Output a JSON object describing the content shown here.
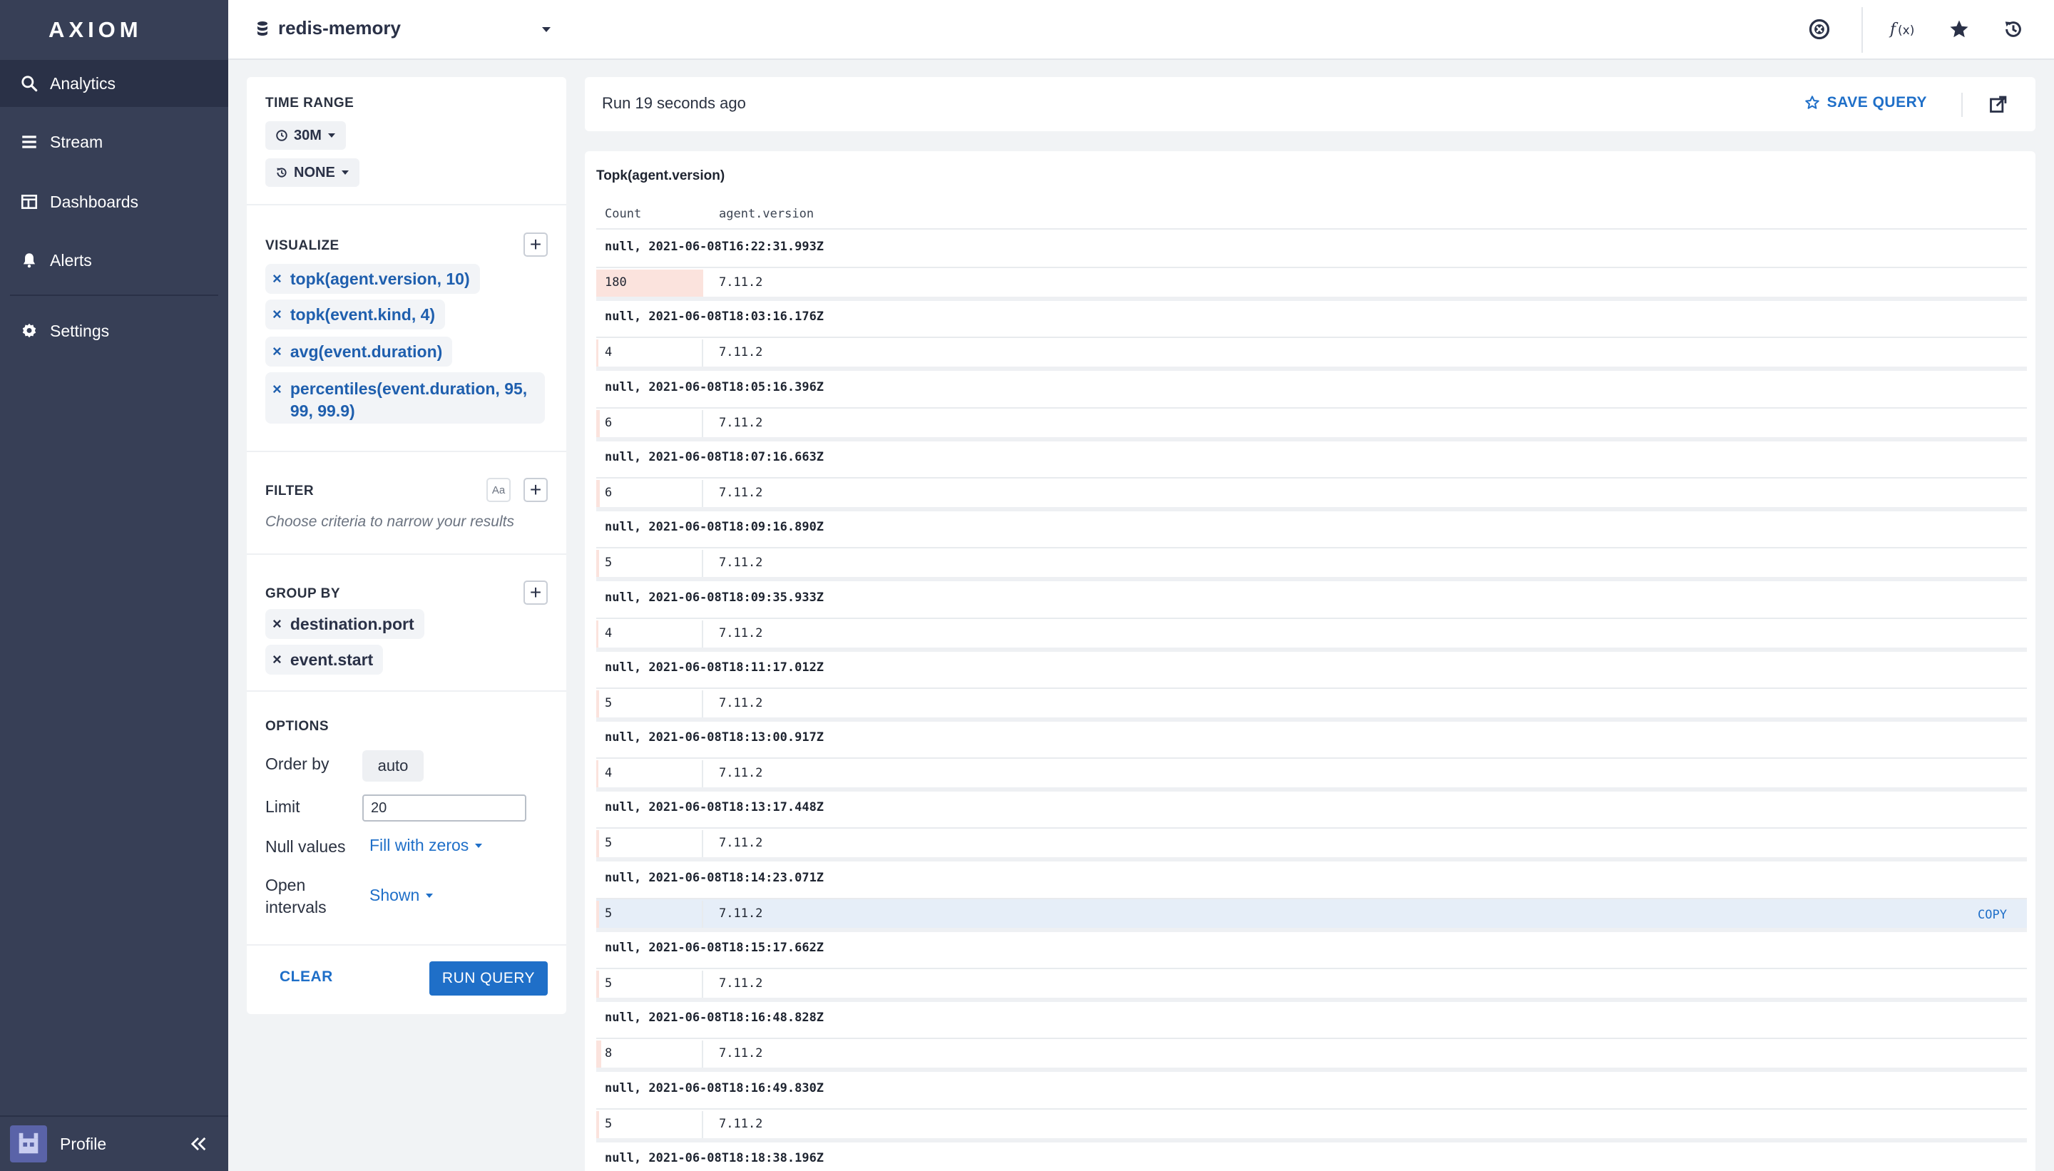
{
  "colors": {
    "sidebar": "#373f56",
    "accent": "#1f6fc8",
    "count_bar": "#fbe3dd"
  },
  "sidebar": {
    "logo": "AXIOM",
    "items": [
      {
        "label": "Analytics",
        "icon": "search-icon",
        "active": true
      },
      {
        "label": "Stream",
        "icon": "stream-icon"
      },
      {
        "label": "Dashboards",
        "icon": "dashboard-icon"
      },
      {
        "label": "Alerts",
        "icon": "bell-icon"
      },
      {
        "label": "Settings",
        "icon": "gear-icon"
      }
    ],
    "profile_label": "Profile"
  },
  "topbar": {
    "dataset": "redis-memory"
  },
  "query": {
    "time_range": {
      "title": "TIME RANGE",
      "range": "30M",
      "compare": "NONE"
    },
    "visualize": {
      "title": "VISUALIZE",
      "items": [
        "topk(agent.version, 10)",
        "topk(event.kind, 4)",
        "avg(event.duration)",
        "percentiles(event.duration, 95, 99, 99.9)"
      ]
    },
    "filter": {
      "title": "FILTER",
      "case_label": "Aa",
      "hint": "Choose criteria to narrow your results"
    },
    "group_by": {
      "title": "GROUP BY",
      "items": [
        "destination.port",
        "event.start"
      ]
    },
    "options": {
      "title": "OPTIONS",
      "order_by_label": "Order by",
      "order_by_value": "auto",
      "limit_label": "Limit",
      "limit_value": "20",
      "null_label": "Null values",
      "null_value": "Fill with zeros",
      "open_label": "Open intervals",
      "open_value": "Shown"
    },
    "clear_label": "CLEAR",
    "run_label": "RUN QUERY"
  },
  "results": {
    "run_status": "Run 19 seconds ago",
    "save_label": "SAVE QUERY",
    "title": "Topk(agent.version)",
    "col_count": "Count",
    "col_version": "agent.version",
    "copy_label": "COPY",
    "max_count": 180,
    "groups": [
      {
        "title": "null, 2021-06-08T16:22:31.993Z",
        "count": 180,
        "version": "7.11.2"
      },
      {
        "title": "null, 2021-06-08T18:03:16.176Z",
        "count": 4,
        "version": "7.11.2"
      },
      {
        "title": "null, 2021-06-08T18:05:16.396Z",
        "count": 6,
        "version": "7.11.2"
      },
      {
        "title": "null, 2021-06-08T18:07:16.663Z",
        "count": 6,
        "version": "7.11.2"
      },
      {
        "title": "null, 2021-06-08T18:09:16.890Z",
        "count": 5,
        "version": "7.11.2"
      },
      {
        "title": "null, 2021-06-08T18:09:35.933Z",
        "count": 4,
        "version": "7.11.2"
      },
      {
        "title": "null, 2021-06-08T18:11:17.012Z",
        "count": 5,
        "version": "7.11.2"
      },
      {
        "title": "null, 2021-06-08T18:13:00.917Z",
        "count": 4,
        "version": "7.11.2"
      },
      {
        "title": "null, 2021-06-08T18:13:17.448Z",
        "count": 5,
        "version": "7.11.2"
      },
      {
        "title": "null, 2021-06-08T18:14:23.071Z",
        "count": 5,
        "version": "7.11.2",
        "highlight": true
      },
      {
        "title": "null, 2021-06-08T18:15:17.662Z",
        "count": 5,
        "version": "7.11.2"
      },
      {
        "title": "null, 2021-06-08T18:16:48.828Z",
        "count": 8,
        "version": "7.11.2"
      },
      {
        "title": "null, 2021-06-08T18:16:49.830Z",
        "count": 5,
        "version": "7.11.2"
      },
      {
        "title": "null, 2021-06-08T18:18:38.196Z",
        "count": null,
        "version": null
      }
    ]
  }
}
